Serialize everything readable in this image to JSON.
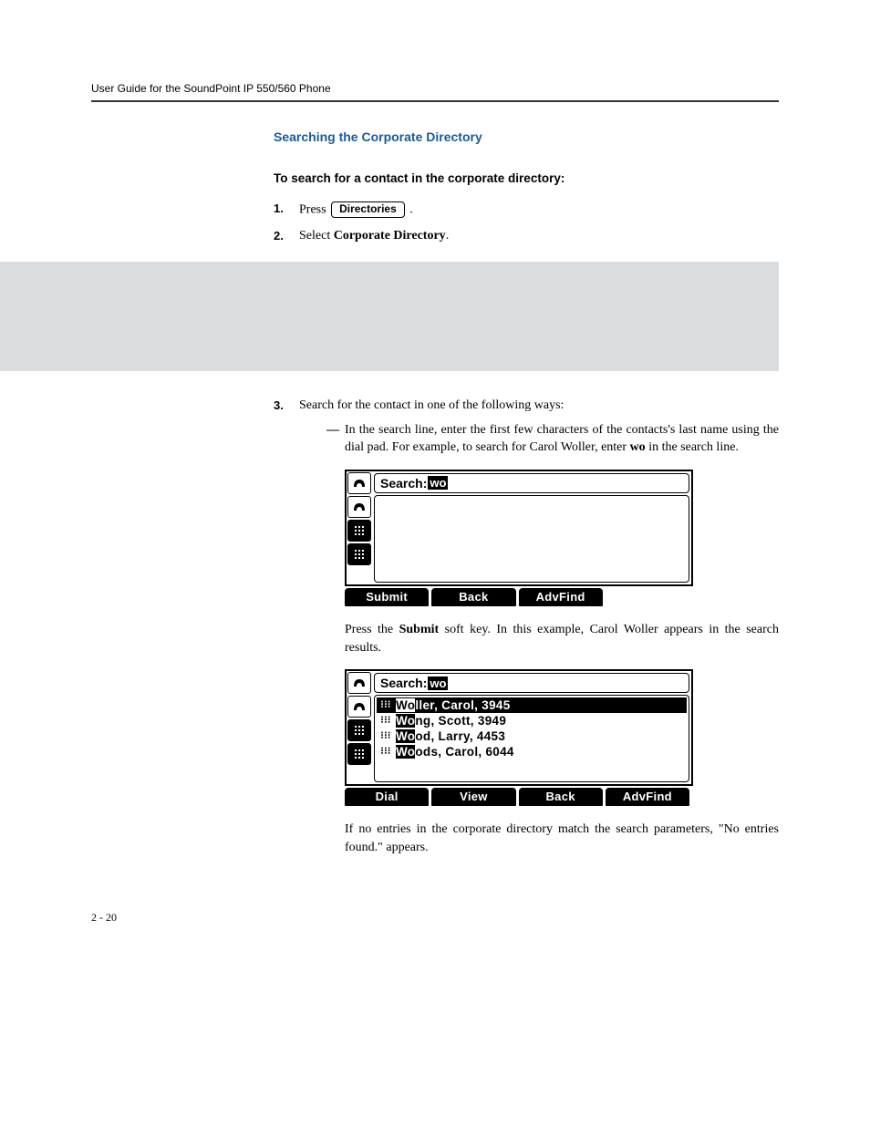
{
  "header": {
    "title": "User Guide for the SoundPoint IP 550/560 Phone"
  },
  "section": {
    "heading": "Searching the Corporate Directory"
  },
  "procedure": {
    "title": "To search for a contact in the corporate directory:"
  },
  "steps": {
    "s1_prefix": "Press",
    "s1_button": "Directories",
    "s1_suffix": ".",
    "s2_prefix": "Select ",
    "s2_bold": "Corporate Directory",
    "s2_suffix": ".",
    "s3": "Search for the contact in one of the following ways:"
  },
  "dash_item": {
    "line1": "In the search line, enter the first few characters of the contacts's last name using the dial pad. For example, to search for Carol Woller, enter ",
    "bold1": "wo",
    "line1_suffix": " in the search line."
  },
  "screen1": {
    "search_label": "Search:",
    "search_query": "wo",
    "softkeys": [
      "Submit",
      "Back",
      "AdvFind",
      ""
    ]
  },
  "para1": {
    "prefix": "Press the ",
    "bold": "Submit",
    "suffix": " soft key. In this example, Carol Woller appears in the search results."
  },
  "screen2": {
    "search_label": "Search:",
    "search_query": "wo",
    "results": [
      {
        "hl": "Wo",
        "rest": "ller, Carol, 3945",
        "selected": true
      },
      {
        "hl": "Wo",
        "rest": "ng, Scott, 3949",
        "selected": false
      },
      {
        "hl": "Wo",
        "rest": "od, Larry, 4453",
        "selected": false
      },
      {
        "hl": "Wo",
        "rest": "ods, Carol, 6044",
        "selected": false
      }
    ],
    "softkeys": [
      "Dial",
      "View",
      "Back",
      "AdvFind"
    ]
  },
  "para2": "If no entries in the corporate directory match the search parameters, \"No entries found.\" appears.",
  "footer": {
    "pagenum": "2 - 20"
  }
}
